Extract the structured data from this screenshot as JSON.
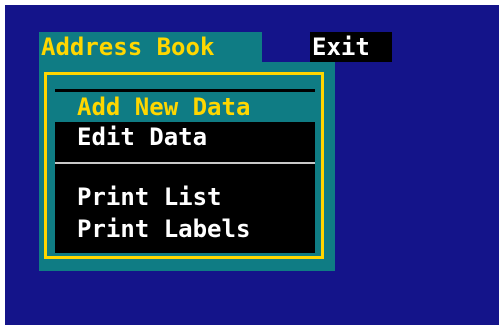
{
  "menu_bar": {
    "address_book_label": "Address Book",
    "exit_label": "Exit"
  },
  "dropdown": {
    "items": [
      {
        "label": "Add New Data",
        "selected": true
      },
      {
        "label": "Edit Data",
        "selected": false
      },
      {
        "label": "Print List",
        "selected": false
      },
      {
        "label": "Print Labels",
        "selected": false
      }
    ]
  },
  "colors": {
    "background": "#14148a",
    "highlight": "#0f7c84",
    "accent": "#ffd700",
    "menu_bg": "#000000",
    "text": "#ffffff"
  }
}
